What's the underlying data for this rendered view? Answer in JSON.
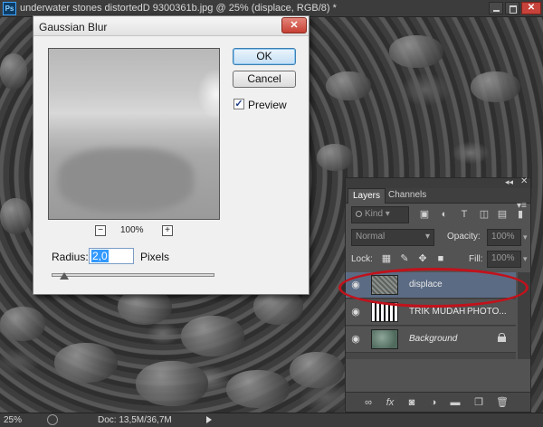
{
  "app": {
    "logo": "Ps",
    "window_title": "underwater stones distortedD 9300361b.jpg @ 25% (displace, RGB/8) *"
  },
  "window_controls": {
    "close_label": "✕"
  },
  "dialog": {
    "title": "Gaussian Blur",
    "close_label": "✕",
    "ok_label": "OK",
    "cancel_label": "Cancel",
    "preview_label": "Preview",
    "preview_checked": true,
    "zoom_out_label": "−",
    "zoom_in_label": "+",
    "zoom_percent": "100%",
    "radius_label": "Radius:",
    "radius_value": "2,0",
    "radius_unit": "Pixels",
    "slider_position": 0.08
  },
  "layers_panel": {
    "tabs": [
      "Layers",
      "Channels"
    ],
    "filter_kind": "Kind",
    "blend_mode": "Normal",
    "opacity_label": "Opacity:",
    "opacity_value": "100%",
    "lock_label": "Lock:",
    "fill_label": "Fill:",
    "fill_value": "100%",
    "layers": [
      {
        "name": "displace",
        "selected": true,
        "italic": false
      },
      {
        "name": "TRIK MUDAH",
        "name_suffix": "PHOTO...",
        "selected": false,
        "italic": false
      },
      {
        "name": "Background",
        "selected": false,
        "italic": true,
        "locked": true
      }
    ],
    "footer_icons": [
      "link-icon",
      "fx-icon",
      "mask-icon",
      "adjustment-icon",
      "group-icon",
      "new-layer-icon",
      "trash-icon"
    ]
  },
  "status_bar": {
    "zoom": "25%",
    "doc_info": "Doc: 13,5M/36,7M"
  },
  "colors": {
    "highlight": "#c1121c",
    "selected_layer": "#5b6b84",
    "dialog_bg": "#f0f0f0"
  }
}
